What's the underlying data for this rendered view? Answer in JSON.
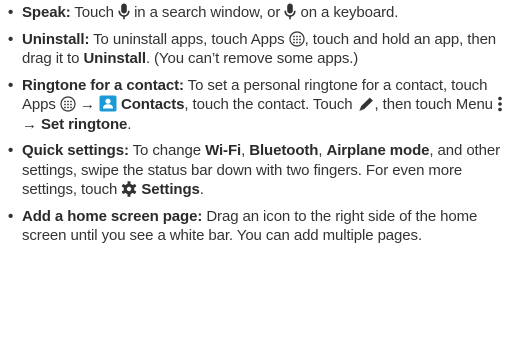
{
  "tips": [
    {
      "title": "Speak:",
      "t1": "Touch",
      "t2": "in a search window, or",
      "t3": "on a keyboard.",
      "icons": [
        "microphone-icon",
        "microphone-icon"
      ]
    },
    {
      "title": "Uninstall:",
      "t1": "To uninstall apps, touch Apps",
      "t2": ", touch and hold an app, then drag it to",
      "bold1": "Uninstall",
      "t3": ". (You can’t remove some apps.)",
      "icons": [
        "apps-icon"
      ]
    },
    {
      "title": "Ringtone for a contact:",
      "t1": "To set a personal ringtone for a contact, touch Apps",
      "arrow": "→",
      "bold1": "Contacts",
      "t2": ", touch the contact. Touch",
      "t3": ", then touch Menu",
      "bold2": "Set ringtone",
      "t4": ".",
      "icons": [
        "apps-icon",
        "contacts-icon",
        "pencil-icon",
        "menu-icon"
      ]
    },
    {
      "title": "Quick settings:",
      "t1": "To change",
      "bold1": "Wi-Fi",
      "sep": ",",
      "bold2": "Bluetooth",
      "bold3": "Airplane mode",
      "t2": ", and other settings, swipe the status bar down with two fingers. For even more settings, touch",
      "bold4": "Settings",
      "t3": ".",
      "icons": [
        "gear-icon"
      ]
    },
    {
      "title": "Add a home screen page:",
      "t1": "Drag an icon to the right side of the home screen until you see a white bar. You can add multiple pages."
    }
  ],
  "bullet": "•",
  "colors": {
    "text": "#333333",
    "contacts_blue": "#1a9bd7"
  }
}
